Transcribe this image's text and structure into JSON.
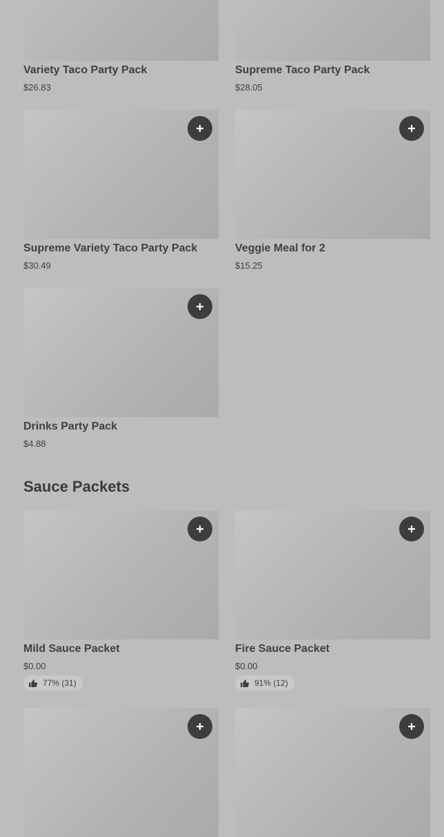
{
  "items_top": [
    {
      "name": "Variety Taco Party Pack",
      "price": "$26.83"
    },
    {
      "name": "Supreme Taco Party Pack",
      "price": "$28.05"
    },
    {
      "name": "Supreme Variety Taco Party Pack",
      "price": "$30.49"
    },
    {
      "name": "Veggie Meal for 2",
      "price": "$15.25"
    },
    {
      "name": "Drinks Party Pack",
      "price": "$4.88"
    }
  ],
  "sauce_section": {
    "title": "Sauce Packets",
    "items": [
      {
        "name": "Mild Sauce Packet",
        "price": "$0.00",
        "rating": "77% (31)"
      },
      {
        "name": "Fire Sauce Packet",
        "price": "$0.00",
        "rating": "91% (12)"
      }
    ]
  },
  "icons": {
    "add": "plus-icon",
    "rating": "thumbs-up-icon"
  },
  "colors": {
    "background": "#bdbdbd",
    "add_button": "#3d3d3d",
    "text": "#404040"
  }
}
